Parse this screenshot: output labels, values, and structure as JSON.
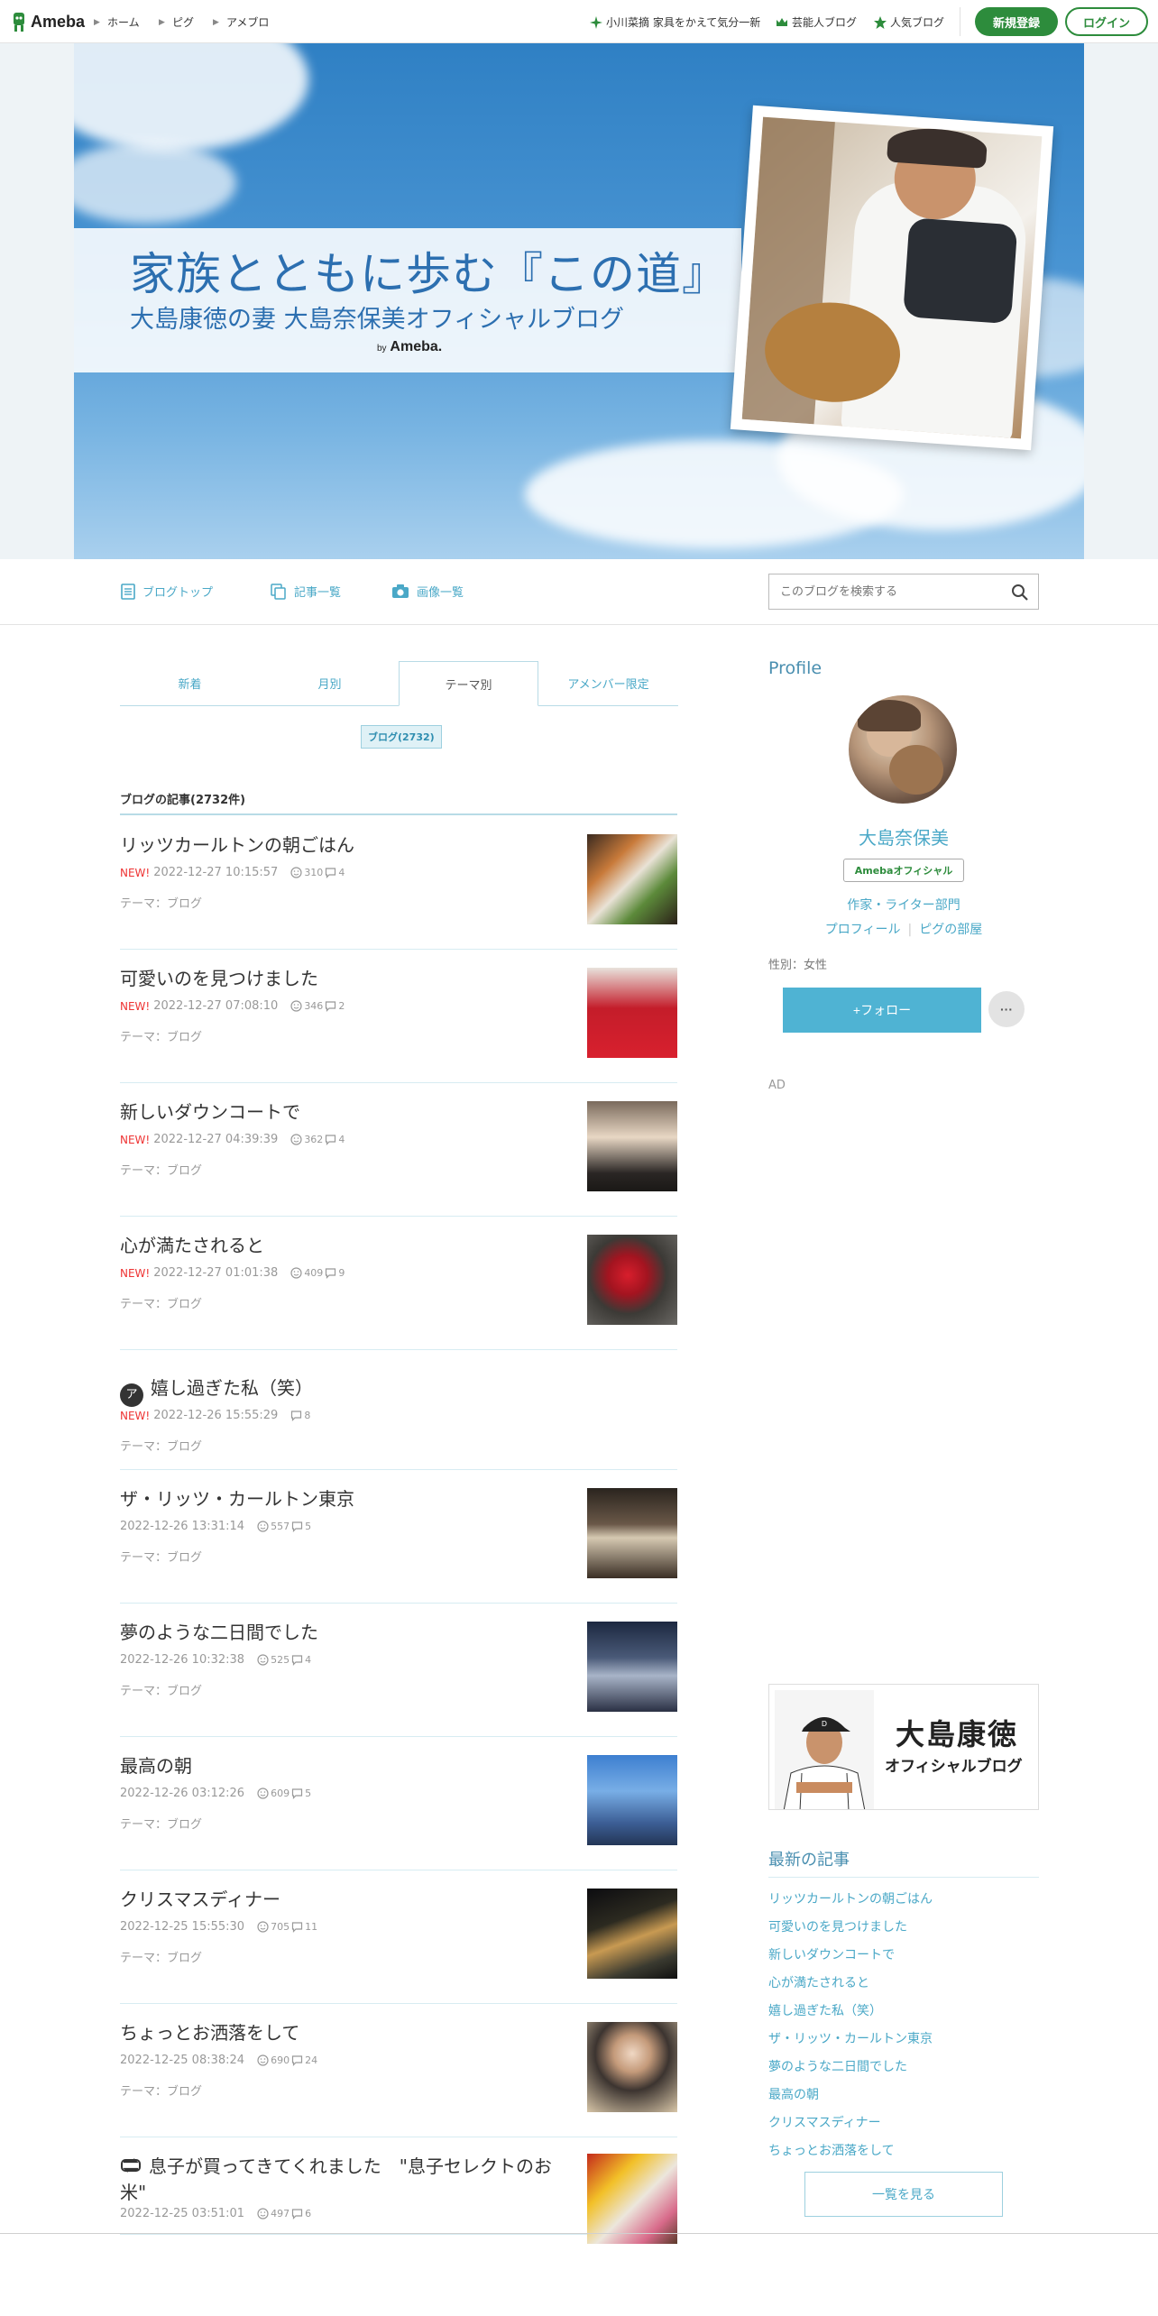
{
  "header": {
    "logo_text": "Ameba",
    "nav": [
      "ホーム",
      "ピグ",
      "アメブロ"
    ],
    "promo_link": "小川菜摘 家具をかえて気分一新",
    "celebrity_blog_link": "芸能人ブログ",
    "popular_blog_link": "人気ブログ",
    "register_label": "新規登録",
    "login_label": "ログイン"
  },
  "hero": {
    "title": "家族とともに歩む『この道』",
    "subtitle": "大島康徳の妻 大島奈保美オフィシャルブログ",
    "by_prefix": "by",
    "by_brand": "Ameba."
  },
  "subnav": {
    "blog_top": "ブログトップ",
    "article_list": "記事一覧",
    "image_list": "画像一覧",
    "search_placeholder": "このブログを検索する"
  },
  "tabs": [
    "新着",
    "月別",
    "テーマ別",
    "アメンバー限定"
  ],
  "tag_chip": "ブログ(2732)",
  "list_heading": "ブログの記事(2732件)",
  "entries": [
    {
      "title": "リッツカールトンの朝ごはん",
      "new": "NEW!",
      "date": "2022-12-27 10:15:57",
      "likes": "310",
      "comments": "4",
      "theme": "テーマ：ブログ",
      "thumb": "food"
    },
    {
      "title": "可愛いのを見つけました",
      "new": "NEW!",
      "date": "2022-12-27 07:08:10",
      "likes": "346",
      "comments": "2",
      "theme": "テーマ：ブログ",
      "thumb": "red"
    },
    {
      "title": "新しいダウンコートで",
      "new": "NEW!",
      "date": "2022-12-27 04:39:39",
      "likes": "362",
      "comments": "4",
      "theme": "テーマ：ブログ",
      "thumb": "person"
    },
    {
      "title": "心が満たされると",
      "new": "NEW!",
      "date": "2022-12-27 01:01:38",
      "likes": "409",
      "comments": "9",
      "theme": "テーマ：ブログ",
      "thumb": "flower"
    },
    {
      "title": "嬉し過ぎた私（笑）",
      "new": "NEW!",
      "date": "2022-12-26 15:55:29",
      "likes": "",
      "comments": "8",
      "theme": "テーマ：ブログ",
      "thumb": ""
    },
    {
      "title": "ザ・リッツ・カールトン東京",
      "new": "",
      "date": "2022-12-26 13:31:14",
      "likes": "557",
      "comments": "5",
      "theme": "テーマ：ブログ",
      "thumb": "lamp"
    },
    {
      "title": "夢のような二日間でした",
      "new": "",
      "date": "2022-12-26 10:32:38",
      "likes": "525",
      "comments": "4",
      "theme": "テーマ：ブログ",
      "thumb": "city"
    },
    {
      "title": "最高の朝",
      "new": "",
      "date": "2022-12-26 03:12:26",
      "likes": "609",
      "comments": "5",
      "theme": "テーマ：ブログ",
      "thumb": "sky"
    },
    {
      "title": "クリスマスディナー",
      "new": "",
      "date": "2022-12-25 15:55:30",
      "likes": "705",
      "comments": "11",
      "theme": "テーマ：ブログ",
      "thumb": "night"
    },
    {
      "title": "ちょっとお洒落をして",
      "new": "",
      "date": "2022-12-25 08:38:24",
      "likes": "690",
      "comments": "24",
      "theme": "テーマ：ブログ",
      "thumb": "woman"
    },
    {
      "title": "息子が買ってきてくれました　\"息子セレクトのお米\"",
      "new": "",
      "date": "2022-12-25 03:51:01",
      "likes": "497",
      "comments": "6",
      "theme": "",
      "thumb": "mc"
    }
  ],
  "profile": {
    "heading": "Profile",
    "name": "大島奈保美",
    "badge": "Amebaオフィシャル",
    "category": "作家・ライター部門",
    "link_profile": "プロフィール",
    "link_pig": "ピグの部屋",
    "gender": "性別：女性",
    "follow_label": "+フォロー",
    "more_label": "···",
    "ad_label": "AD"
  },
  "banner": {
    "name": "大島康徳",
    "sub": "オフィシャルブログ"
  },
  "latest": {
    "heading": "最新の記事",
    "items": [
      "リッツカールトンの朝ごはん",
      "可愛いのを見つけました",
      "新しいダウンコートで",
      "心が満たされると",
      "嬉し過ぎた私（笑）",
      "ザ・リッツ・カールトン東京",
      "夢のような二日間でした",
      "最高の朝",
      "クリスマスディナー",
      "ちょっとお洒落をして"
    ],
    "see_all": "一覧を見る"
  },
  "colors": {
    "brand_green": "#2d8c3c",
    "link_blue": "#4aa8c7",
    "new_red": "#e33"
  }
}
